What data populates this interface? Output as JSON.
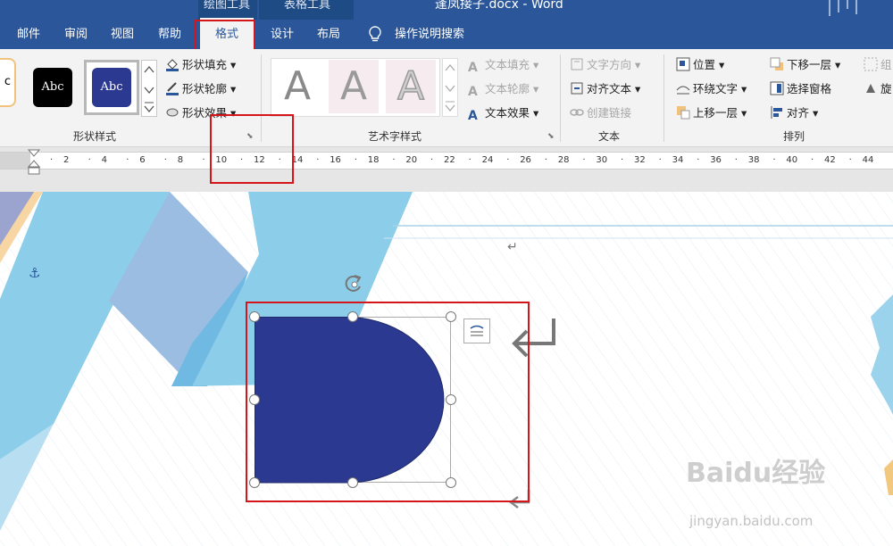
{
  "window": {
    "title": "逢凤接子.docx - Word",
    "context_tab_left": "绘图工具",
    "context_tab_right": "表格工具"
  },
  "tabs": [
    {
      "label": "邮件"
    },
    {
      "label": "审阅"
    },
    {
      "label": "视图"
    },
    {
      "label": "帮助"
    },
    {
      "label": "格式",
      "active": true
    },
    {
      "label": "设计"
    },
    {
      "label": "布局"
    }
  ],
  "tell_me": "操作说明搜索",
  "shape_styles": {
    "label": "形状样式",
    "thumb_partial": "c",
    "thumb1": "Abc",
    "thumb2": "Abc",
    "fill": "形状填充",
    "outline": "形状轮廓",
    "effects": "形状效果"
  },
  "wordart": {
    "label": "艺术字样式",
    "letters": [
      "A",
      "A",
      "A"
    ],
    "text_fill": "文本填充",
    "text_outline": "文本轮廓",
    "text_effects": "文本效果"
  },
  "text_group": {
    "label": "文本",
    "direction": "文字方向",
    "align_text": "对齐文本",
    "create_link": "创建链接"
  },
  "arrange": {
    "label": "排列",
    "position": "位置",
    "wrap": "环绕文字",
    "bring_forward": "上移一层",
    "send_backward": "下移一层",
    "selection_pane": "选择窗格",
    "align": "对齐",
    "group_partial": "组",
    "rotate_partial": "旋"
  },
  "ruler_numbers": [
    "2",
    "4",
    "6",
    "8",
    "10",
    "12",
    "14",
    "16",
    "18",
    "20",
    "22",
    "24",
    "26",
    "28",
    "30",
    "32",
    "34",
    "36",
    "38",
    "40",
    "42",
    "44"
  ],
  "colors": {
    "word_blue": "#2b579a",
    "shape_fill": "#2b3990",
    "highlight_red": "#d4161b"
  },
  "watermark": {
    "brand": "Baidu经验",
    "url": "jingyan.baidu.com"
  }
}
